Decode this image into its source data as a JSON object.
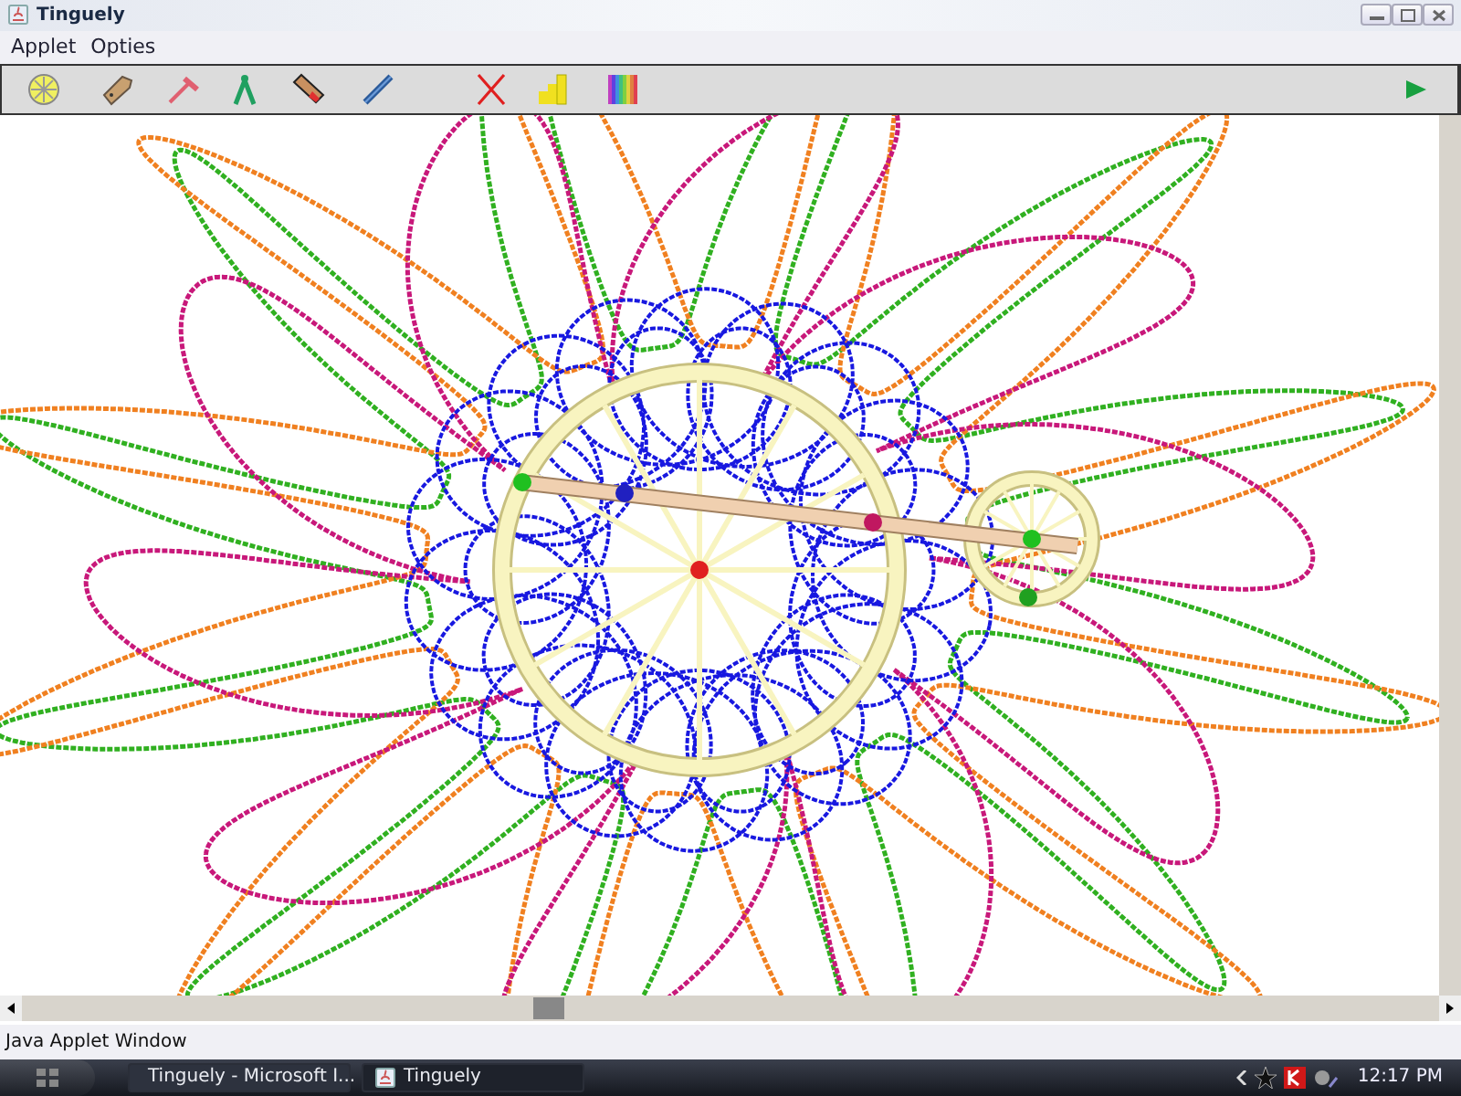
{
  "window": {
    "title": "Tinguely"
  },
  "menu": [
    {
      "label": "Applet"
    },
    {
      "label": "Opties"
    }
  ],
  "status_bar": {
    "text": "Java Applet Window"
  },
  "taskbar": {
    "buttons": [
      {
        "label": "Tinguely - Microsoft I...",
        "kind": "browser",
        "selected": false
      },
      {
        "label": "Tinguely",
        "kind": "java",
        "selected": true
      }
    ],
    "clock": "12:17 PM"
  }
}
